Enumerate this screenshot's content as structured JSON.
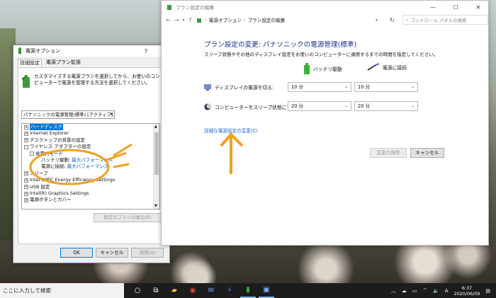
{
  "colors": {
    "accent": "#0078d7",
    "link": "#1b66c9",
    "heading": "#1e3287",
    "annotation": "#f0a020"
  },
  "dialog": {
    "title": "電源オプション",
    "help": "?",
    "close": "X",
    "tabs": [
      "詳細設定",
      "電源プラン拡張"
    ],
    "description": "カスタマイズする電源プランを選択してから、お使いのコンピューターで電源を管理する方法を選択してください。",
    "plan_select": "パナソニックの電源管理(標準) [アクティブ]",
    "tree": [
      {
        "label": "ハードディスク",
        "expander": "+",
        "selected": true
      },
      {
        "label": "Internet Explorer",
        "expander": "+"
      },
      {
        "label": "デスクトップの背景の設定",
        "expander": "+"
      },
      {
        "label": "ワイヤレス アダプターの設定",
        "expander": "-"
      },
      {
        "label": "省電力モード",
        "expander": "-",
        "indent": 1
      },
      {
        "label": "バッテリ駆動:",
        "value": "最大パフォーマンス",
        "indent": 2
      },
      {
        "label": "電源に接続:",
        "value": "最大パフォーマンス",
        "indent": 2
      },
      {
        "label": "スリープ",
        "expander": "+"
      },
      {
        "label": "Intel CPPC Energy Efficiency Settings",
        "expander": "+"
      },
      {
        "label": "USB 設定",
        "expander": "+"
      },
      {
        "label": "Intel(R) Graphics Settings",
        "expander": "+"
      },
      {
        "label": "電源ボタンとカバー",
        "expander": "+"
      }
    ],
    "restore_button": "既定のプランの復元(R)",
    "ok": "OK",
    "cancel": "キャンセル",
    "apply": "適用(A)"
  },
  "window": {
    "title": "プラン設定の編集",
    "minimize": "—",
    "maximize": "☐",
    "close": "✕",
    "breadcrumb": [
      "電源オプション",
      "プラン設定の編集"
    ],
    "search_placeholder": "コントロール パネルの検索",
    "heading": "プラン設定の変更: パナソニックの電源管理(標準)",
    "subtitle": "スリープ状態やその他のディスプレイ設定をお使いのコンピューターに適用するまでの時間を指定してください。",
    "col_battery": "バッテリ駆動",
    "col_plugged": "電源に接続",
    "display_label": "ディスプレイの電源を切る:",
    "display_battery": "10 分",
    "display_plugged": "10 分",
    "sleep_label": "コンピューターをスリープ状態にする:",
    "sleep_battery": "20 分",
    "sleep_plugged": "20 分",
    "advanced_link": "詳細な電源設定の変更(C)",
    "save": "変更の保存",
    "cancel": "キャンセル"
  },
  "taskbar": {
    "search": "ここに入力して検索",
    "time": "6:37",
    "date": "2020/06/09",
    "ime": "A"
  }
}
